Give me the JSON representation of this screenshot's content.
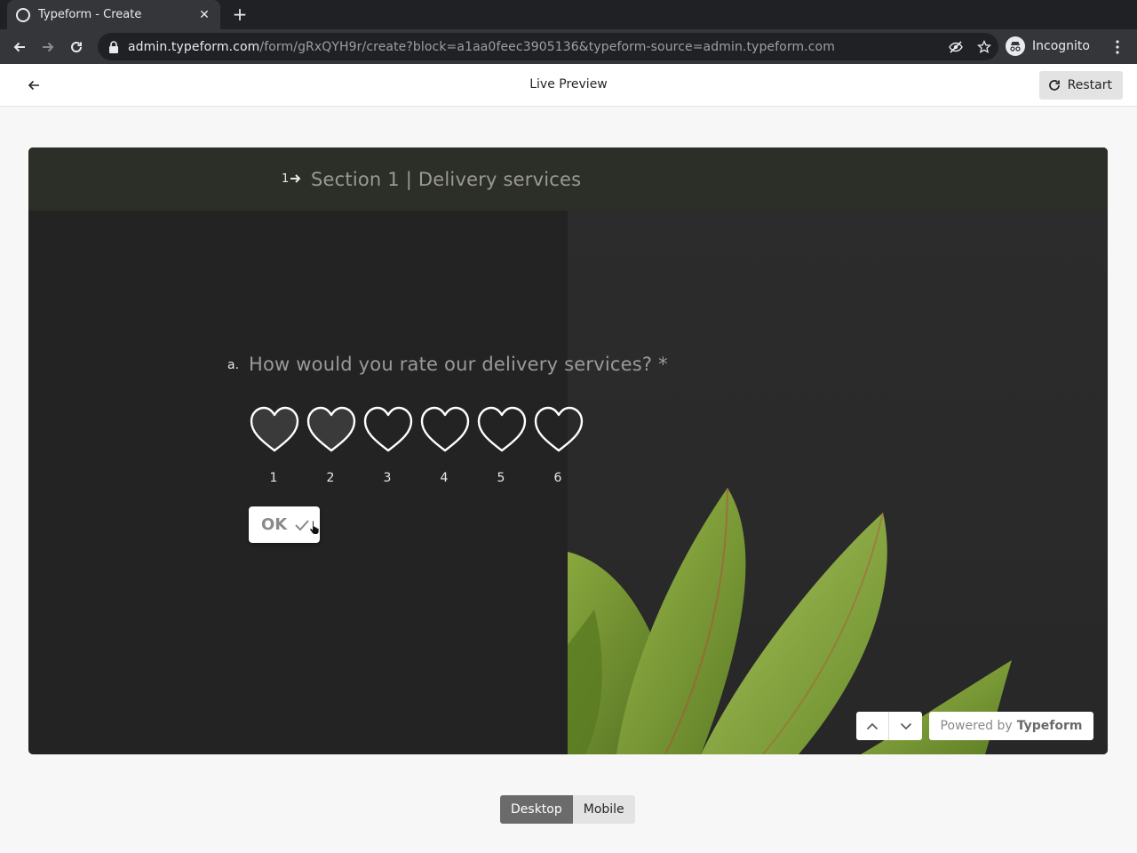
{
  "browser": {
    "tab_title": "Typeform - Create",
    "new_tab_label": "+",
    "url_host": "admin.typeform.com",
    "url_path": "/form/gRxQYH9r/create?block=a1aa0feec3905136&typeform-source=admin.typeform.com",
    "profile_label": "Incognito"
  },
  "header": {
    "title": "Live Preview",
    "restart_label": "Restart"
  },
  "form": {
    "section_number": "1",
    "section_title": "Section 1 | Delivery services",
    "question_letter": "a.",
    "question_text": "How would you rate our delivery services? *",
    "rating": {
      "max": 6,
      "selected": 2,
      "labels": [
        "1",
        "2",
        "3",
        "4",
        "5",
        "6"
      ]
    },
    "ok_label": "OK"
  },
  "footer": {
    "powered_prefix": "Powered by",
    "powered_brand": "Typeform"
  },
  "device_toggle": {
    "desktop_label": "Desktop",
    "mobile_label": "Mobile",
    "active": "Desktop"
  },
  "colors": {
    "preview_bg": "#232323",
    "section_bar": "#2c2e28",
    "heart_stroke": "#ffffff",
    "heart_filled": "#3a3a3a",
    "leaf_green": "#7fa03a"
  },
  "icons": {
    "tab_favicon": "typeform-favicon-icon",
    "back": "arrow-left-icon",
    "forward": "arrow-right-icon",
    "reload": "reload-icon",
    "lock": "lock-icon",
    "eye_off": "eye-off-icon",
    "star": "star-icon",
    "incognito": "incognito-icon",
    "menu": "kebab-menu-icon",
    "restart": "restart-icon",
    "heart": "heart-icon",
    "check": "check-icon",
    "chevron_up": "chevron-up-icon",
    "chevron_down": "chevron-down-icon"
  }
}
